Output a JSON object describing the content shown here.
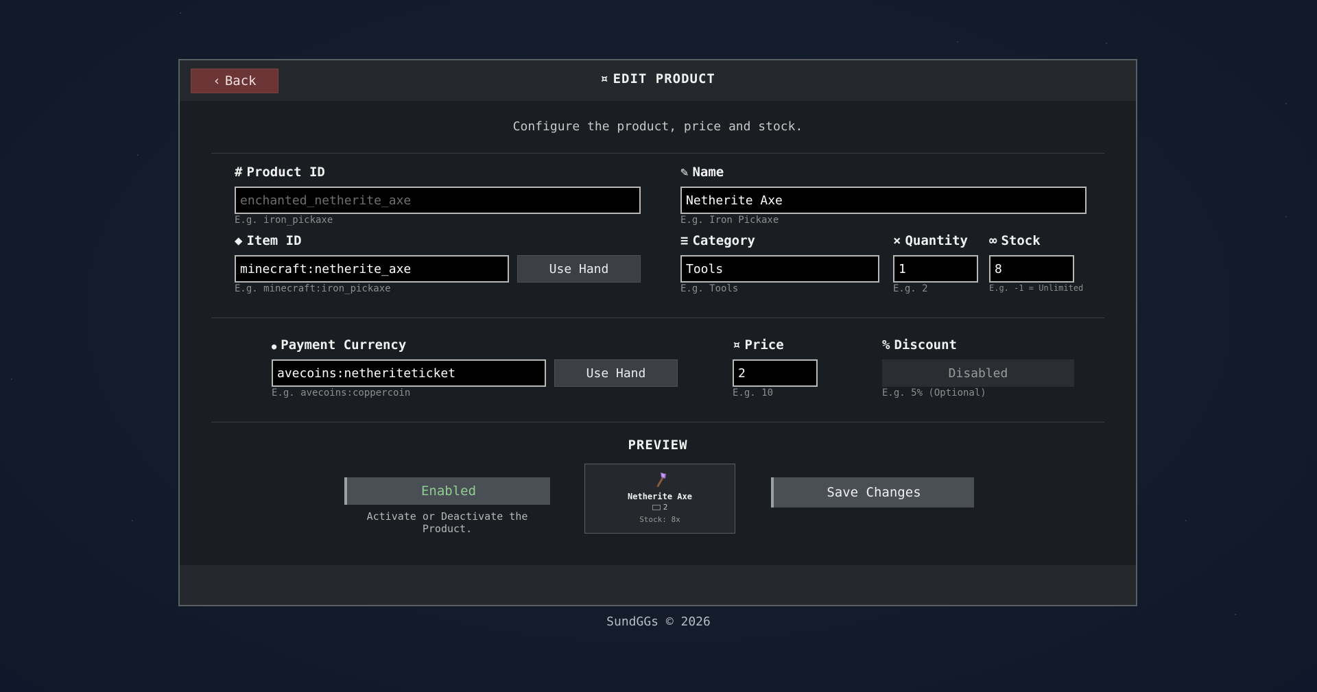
{
  "header": {
    "back_label": "Back",
    "title": "EDIT PRODUCT",
    "title_icon": "¤"
  },
  "subtitle": "Configure the product, price and stock.",
  "fields": {
    "product_id": {
      "icon": "#",
      "label": "Product ID",
      "value": "enchanted_netherite_axe",
      "hint": "E.g. iron_pickaxe"
    },
    "name": {
      "icon": "✎",
      "label": "Name",
      "value": "Netherite Axe",
      "hint": "E.g. Iron Pickaxe"
    },
    "item_id": {
      "icon": "◆",
      "label": "Item ID",
      "value": "minecraft:netherite_axe",
      "hint": "E.g. minecraft:iron_pickaxe",
      "button": "Use Hand"
    },
    "category": {
      "icon": "≡",
      "label": "Category",
      "value": "Tools",
      "hint": "E.g. Tools"
    },
    "quantity": {
      "icon": "×",
      "label": "Quantity",
      "value": "1",
      "hint": "E.g. 2"
    },
    "stock": {
      "icon": "∞",
      "label": "Stock",
      "value": "8",
      "hint": "E.g. -1 = Unlimited"
    },
    "payment_currency": {
      "icon": "●",
      "label": "Payment Currency",
      "value": "avecoins:netheriteticket",
      "hint": "E.g. avecoins:coppercoin",
      "button": "Use Hand"
    },
    "price": {
      "icon": "¤",
      "label": "Price",
      "value": "2",
      "hint": "E.g. 10"
    },
    "discount": {
      "icon": "%",
      "label": "Discount",
      "value": "Disabled",
      "hint": "E.g. 5% (Optional)"
    }
  },
  "preview": {
    "title": "PREVIEW",
    "toggle_label": "Enabled",
    "toggle_hint": "Activate or Deactivate the Product.",
    "card_name": "Netherite Axe",
    "card_price": "2",
    "card_stock": "Stock: 8x",
    "save_label": "Save Changes"
  },
  "footer": {
    "copyright": "SundGGs © 2026"
  },
  "colors": {
    "background": "#141c2b",
    "panel": "#1a1d21",
    "back_button": "#6b3535",
    "enabled_text": "#8fcf8f"
  }
}
